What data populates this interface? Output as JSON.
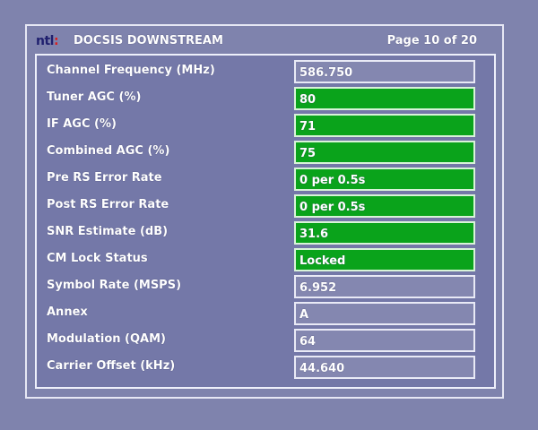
{
  "header": {
    "logo_text": "ntl:",
    "title": "DOCSIS DOWNSTREAM",
    "page_indicator": "Page 10 of 20"
  },
  "rows": [
    {
      "label": "Channel Frequency (MHz)",
      "value": "586.750",
      "status": "plain"
    },
    {
      "label": "Tuner AGC (%)",
      "value": "80",
      "status": "ok"
    },
    {
      "label": "IF AGC (%)",
      "value": "71",
      "status": "ok"
    },
    {
      "label": "Combined AGC (%)",
      "value": "75",
      "status": "ok"
    },
    {
      "label": "Pre RS Error Rate",
      "value": "0 per 0.5s",
      "status": "ok"
    },
    {
      "label": "Post RS Error Rate",
      "value": "0 per 0.5s",
      "status": "ok"
    },
    {
      "label": "SNR Estimate (dB)",
      "value": "31.6",
      "status": "ok"
    },
    {
      "label": "CM Lock Status",
      "value": "Locked",
      "status": "ok"
    },
    {
      "label": "Symbol Rate (MSPS)",
      "value": "6.952",
      "status": "plain"
    },
    {
      "label": "Annex",
      "value": "A",
      "status": "plain"
    },
    {
      "label": "Modulation (QAM)",
      "value": "64",
      "status": "plain"
    },
    {
      "label": "Carrier Offset (kHz)",
      "value": "44.640",
      "status": "plain"
    }
  ],
  "colors": {
    "background": "#7f83ad",
    "status_ok": "#0aa31b",
    "status_plain": "#8487b0",
    "text": "#ffffff"
  }
}
